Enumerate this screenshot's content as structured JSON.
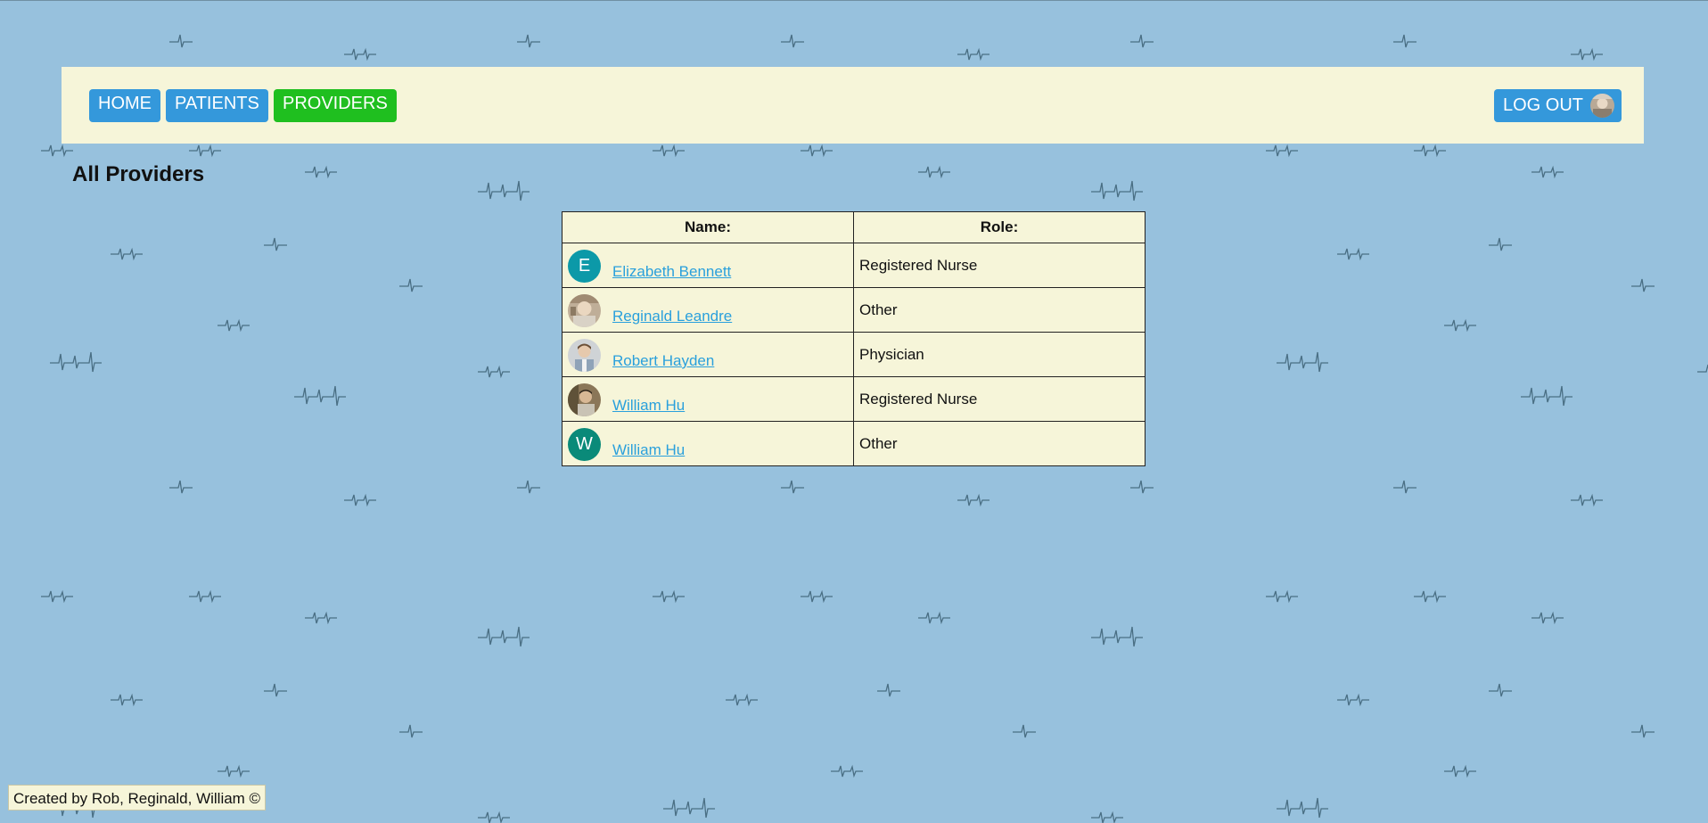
{
  "nav": {
    "home_label": "HOME",
    "patients_label": "PATIENTS",
    "providers_label": "PROVIDERS",
    "logout_label": "LOG OUT"
  },
  "page_title": "All Providers",
  "table": {
    "headers": {
      "name": "Name:",
      "role": "Role:"
    },
    "rows": [
      {
        "name": "Elizabeth Bennett",
        "role": "Registered Nurse",
        "avatar_initial": "E",
        "avatar_color": "#0c99a8",
        "avatar_type": "initial"
      },
      {
        "name": "Reginald Leandre",
        "role": "Other",
        "avatar_initial": "",
        "avatar_type": "photo"
      },
      {
        "name": "Robert Hayden",
        "role": "Physician",
        "avatar_initial": "",
        "avatar_type": "photo"
      },
      {
        "name": "William Hu",
        "role": "Registered Nurse",
        "avatar_initial": "",
        "avatar_type": "photo"
      },
      {
        "name": "William Hu",
        "role": "Other",
        "avatar_initial": "W",
        "avatar_color": "#0a8a79",
        "avatar_type": "initial"
      }
    ]
  },
  "footer": {
    "text": "Created by Rob, Reginald, William ©"
  },
  "colors": {
    "background": "#97c1dd",
    "panel": "#f6f5d9",
    "nav_button": "#3498db",
    "nav_active": "#1fbf1f",
    "link": "#2aa0dc"
  }
}
